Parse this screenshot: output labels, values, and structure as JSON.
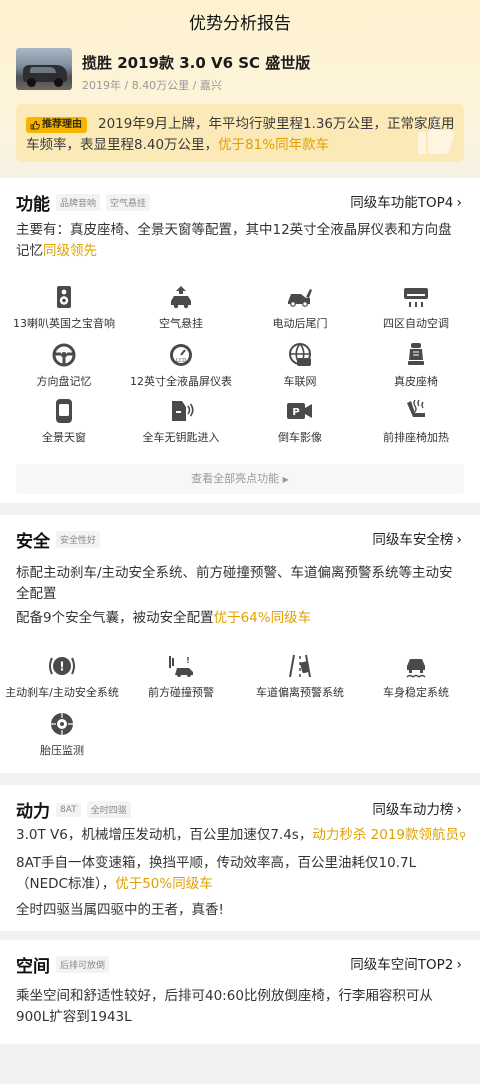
{
  "header": {
    "title": "优势分析报告"
  },
  "car": {
    "name": "揽胜 2019款 3.0 V6 SC 盛世版",
    "meta": "2019年 / 8.40万公里 / 嘉兴"
  },
  "recommend": {
    "badge": "推荐理由",
    "text": "2019年9月上牌，年平均行驶里程1.36万公里，正常家庭用车频率，表显里程8.40万公里，",
    "highlight": "优于81%同年款车"
  },
  "function_section": {
    "title": "功能",
    "tags": [
      "品牌音响",
      "空气悬挂"
    ],
    "link": "同级车功能TOP4",
    "desc": "主要有：真皮座椅、全景天窗等配置，其中12英寸全液晶屏仪表和方向盘记忆",
    "desc_highlight": "同级领先",
    "items": [
      {
        "label": "13喇叭英国之宝音响",
        "icon": "speaker-icon"
      },
      {
        "label": "空气悬挂",
        "icon": "air-suspension-icon"
      },
      {
        "label": "电动后尾门",
        "icon": "power-tailgate-icon"
      },
      {
        "label": "四区自动空调",
        "icon": "climate-icon"
      },
      {
        "label": "方向盘记忆",
        "icon": "steering-wheel-icon"
      },
      {
        "label": "12英寸全液晶屏仪表",
        "icon": "lcd-gauge-icon"
      },
      {
        "label": "车联网",
        "icon": "connected-car-icon"
      },
      {
        "label": "真皮座椅",
        "icon": "leather-seat-icon"
      },
      {
        "label": "全景天窗",
        "icon": "sunroof-icon"
      },
      {
        "label": "全车无钥匙进入",
        "icon": "keyless-entry-icon"
      },
      {
        "label": "倒车影像",
        "icon": "parking-camera-icon"
      },
      {
        "label": "前排座椅加热",
        "icon": "seat-heating-icon"
      }
    ],
    "more": "查看全部亮点功能"
  },
  "safety_section": {
    "title": "安全",
    "tags": [
      "安全性好"
    ],
    "link": "同级车安全榜",
    "desc1": "标配主动刹车/主动安全系统、前方碰撞预警、车道偏离预警系统等主动安全配置",
    "desc2": "配备9个安全气囊，被动安全配置",
    "desc2_highlight": "优于64%同级车",
    "items": [
      {
        "label": "主动刹车/主动安全系统",
        "icon": "active-brake-icon"
      },
      {
        "label": "前方碰撞预警",
        "icon": "collision-warning-icon"
      },
      {
        "label": "车道偏离预警系统",
        "icon": "lane-departure-icon"
      },
      {
        "label": "车身稳定系统",
        "icon": "stability-control-icon"
      },
      {
        "label": "胎压监测",
        "icon": "tire-pressure-icon"
      }
    ]
  },
  "power_section": {
    "title": "动力",
    "tags": [
      "8AT",
      "全时四驱"
    ],
    "link": "同级车动力榜",
    "line1": "3.0T V6，机械增压发动机，百公里加速仅7.4s，",
    "line1_highlight": "动力秒杀 2019款领航员",
    "line2": "8AT手自一体变速箱，换挡平顺，传动效率高，百公里油耗仅10.7L（NEDC标准），",
    "line2_highlight": "优于50%同级车",
    "line3": "全时四驱当属四驱中的王者，真香!"
  },
  "space_section": {
    "title": "空间",
    "tags": [
      "后排可放倒"
    ],
    "link": "同级车空间TOP2",
    "desc": "乘坐空间和舒适性较好，后排可40:60比例放倒座椅，行李厢容积可从900L扩容到1943L"
  },
  "colors": {
    "accent": "#e0a100",
    "badge": "#f7b500",
    "hero_bg": "#fdf1cf"
  }
}
